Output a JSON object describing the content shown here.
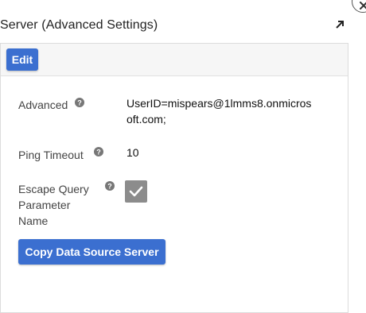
{
  "header": {
    "title": "Server (Advanced Settings)",
    "expand_icon": "arrow-up-right-icon",
    "close_icon": "close-icon"
  },
  "toolbar": {
    "edit_label": "Edit"
  },
  "fields": {
    "advanced": {
      "label": "Advanced",
      "value_line1": "UserID=mispears@1lmms8.onmicros",
      "value_line2": "oft.com;"
    },
    "ping_timeout": {
      "label": "Ping Timeout",
      "value": "10"
    },
    "escape_query": {
      "label_line1": "Escape Query",
      "label_line2": "Parameter",
      "label_line3": "Name",
      "checked": true
    }
  },
  "actions": {
    "copy_label": "Copy Data Source Server"
  },
  "colors": {
    "accent": "#3b6fd0",
    "checkbox": "#8c8c8c",
    "help_icon": "#777777"
  }
}
